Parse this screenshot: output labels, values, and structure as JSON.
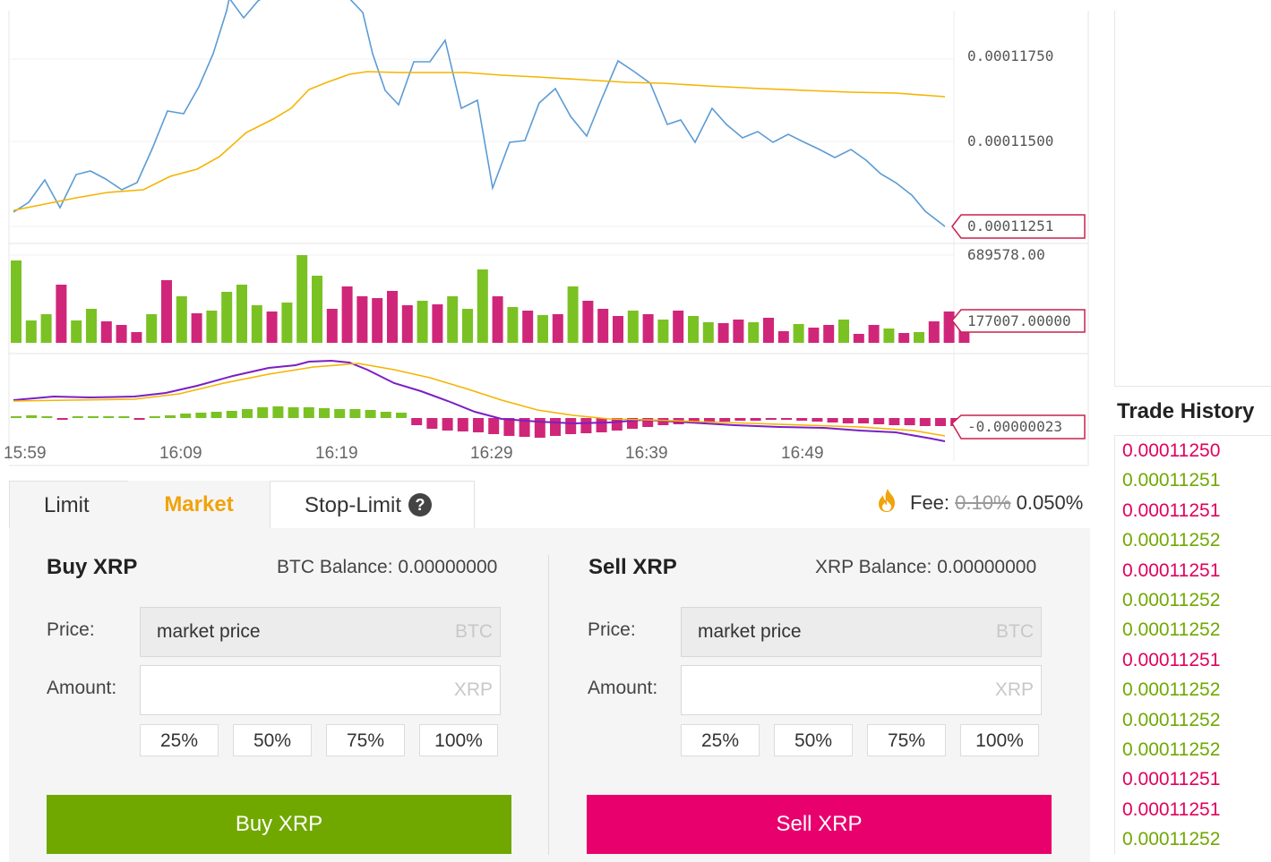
{
  "chart": {
    "price_axis_labels": [
      "0.00011750",
      "0.00011500"
    ],
    "current_price_tag": "0.00011251",
    "volume_max_label": "689578.00",
    "volume_current_tag": "177007.00000",
    "macd_tag": "-0.00000023",
    "time_labels": [
      "15:59",
      "16:09",
      "16:19",
      "16:29",
      "16:39",
      "16:49"
    ],
    "colors": {
      "price_line": "#5b9bd5",
      "ma_line": "#f5b400",
      "volume_up": "#7ac223",
      "volume_down": "#d0267a",
      "macd_line": "#7a1fc4",
      "signal_line": "#f5b400",
      "tag_border": "#c8204f"
    }
  },
  "tabs": {
    "limit": "Limit",
    "market": "Market",
    "stop_limit": "Stop-Limit",
    "help_icon": "?"
  },
  "fee": {
    "label": "Fee:",
    "old": "0.10%",
    "current": "0.050%",
    "icon": "fire-icon"
  },
  "buy": {
    "title": "Buy XRP",
    "balance": "BTC Balance: 0.00000000",
    "price_label": "Price:",
    "price_value": "market price",
    "price_unit": "BTC",
    "amount_label": "Amount:",
    "amount_unit": "XRP",
    "percents": [
      "25%",
      "50%",
      "75%",
      "100%"
    ],
    "button": "Buy XRP"
  },
  "sell": {
    "title": "Sell XRP",
    "balance": "XRP Balance: 0.00000000",
    "price_label": "Price:",
    "price_value": "market price",
    "price_unit": "BTC",
    "amount_label": "Amount:",
    "amount_unit": "XRP",
    "percents": [
      "25%",
      "50%",
      "75%",
      "100%"
    ],
    "button": "Sell XRP"
  },
  "trade_history": {
    "title": "Trade History",
    "trades": [
      {
        "price": "0.00011250",
        "side": "down"
      },
      {
        "price": "0.00011251",
        "side": "up"
      },
      {
        "price": "0.00011251",
        "side": "down"
      },
      {
        "price": "0.00011252",
        "side": "up"
      },
      {
        "price": "0.00011251",
        "side": "down"
      },
      {
        "price": "0.00011252",
        "side": "up"
      },
      {
        "price": "0.00011252",
        "side": "up"
      },
      {
        "price": "0.00011251",
        "side": "down"
      },
      {
        "price": "0.00011252",
        "side": "up"
      },
      {
        "price": "0.00011252",
        "side": "up"
      },
      {
        "price": "0.00011252",
        "side": "up"
      },
      {
        "price": "0.00011251",
        "side": "down"
      },
      {
        "price": "0.00011251",
        "side": "down"
      },
      {
        "price": "0.00011252",
        "side": "up"
      }
    ]
  }
}
